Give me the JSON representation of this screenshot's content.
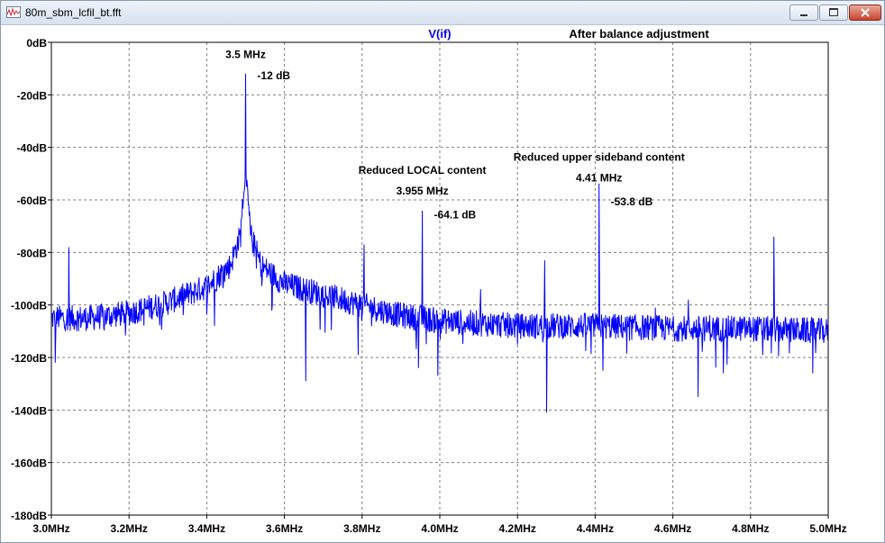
{
  "window": {
    "title": "80m_sbm_lcfil_bt.fft",
    "minimize_label": "minimize",
    "maximize_label": "maximize",
    "close_label": "close"
  },
  "colors": {
    "trace": "#0000ff",
    "axis": "#000000",
    "grid": "#808080",
    "text": "#000000"
  },
  "chart_data": {
    "type": "line",
    "title": "After balance adjustment",
    "trace_label": "V(if)",
    "xlabel": "",
    "ylabel": "",
    "xlim": [
      3.0,
      5.0
    ],
    "ylim": [
      -180,
      0
    ],
    "x_unit": "MHz",
    "y_unit": "dB",
    "grid": true,
    "x_ticks": [
      {
        "v": 3.0,
        "label": "3.0MHz"
      },
      {
        "v": 3.2,
        "label": "3.2MHz"
      },
      {
        "v": 3.4,
        "label": "3.4MHz"
      },
      {
        "v": 3.6,
        "label": "3.6MHz"
      },
      {
        "v": 3.8,
        "label": "3.8MHz"
      },
      {
        "v": 4.0,
        "label": "4.0MHz"
      },
      {
        "v": 4.2,
        "label": "4.2MHz"
      },
      {
        "v": 4.4,
        "label": "4.4MHz"
      },
      {
        "v": 4.6,
        "label": "4.6MHz"
      },
      {
        "v": 4.8,
        "label": "4.8MHz"
      },
      {
        "v": 5.0,
        "label": "5.0MHz"
      }
    ],
    "y_ticks": [
      {
        "v": 0,
        "label": "0dB"
      },
      {
        "v": -20,
        "label": "-20dB"
      },
      {
        "v": -40,
        "label": "-40dB"
      },
      {
        "v": -60,
        "label": "-60dB"
      },
      {
        "v": -80,
        "label": "-80dB"
      },
      {
        "v": -100,
        "label": "-100dB"
      },
      {
        "v": -120,
        "label": "-120dB"
      },
      {
        "v": -140,
        "label": "-140dB"
      },
      {
        "v": -160,
        "label": "-160dB"
      },
      {
        "v": -180,
        "label": "-180dB"
      }
    ],
    "peaks": [
      {
        "x": 3.5,
        "y": -12.0
      },
      {
        "x": 3.955,
        "y": -64.1
      },
      {
        "x": 4.41,
        "y": -53.8
      }
    ],
    "spurs": [
      {
        "x": 3.045,
        "y": -78
      },
      {
        "x": 3.185,
        "y": -104
      },
      {
        "x": 3.31,
        "y": -98
      },
      {
        "x": 3.42,
        "y": -108
      },
      {
        "x": 3.805,
        "y": -77
      },
      {
        "x": 3.98,
        "y": -110
      },
      {
        "x": 4.105,
        "y": -94
      },
      {
        "x": 4.27,
        "y": -83
      },
      {
        "x": 4.31,
        "y": -104
      },
      {
        "x": 4.435,
        "y": -108
      },
      {
        "x": 4.555,
        "y": -101
      },
      {
        "x": 4.64,
        "y": -98
      },
      {
        "x": 4.695,
        "y": -104
      },
      {
        "x": 4.86,
        "y": -74
      }
    ],
    "dips": [
      {
        "x": 3.01,
        "y": -122
      },
      {
        "x": 3.655,
        "y": -129
      },
      {
        "x": 3.79,
        "y": -119
      },
      {
        "x": 3.945,
        "y": -124
      },
      {
        "x": 3.995,
        "y": -127
      },
      {
        "x": 4.275,
        "y": -141
      },
      {
        "x": 4.42,
        "y": -125
      },
      {
        "x": 4.665,
        "y": -135
      },
      {
        "x": 4.73,
        "y": -126
      },
      {
        "x": 4.96,
        "y": -126
      }
    ],
    "noise_floor": [
      {
        "x": 3.0,
        "y": -105
      },
      {
        "x": 3.1,
        "y": -105
      },
      {
        "x": 3.2,
        "y": -103
      },
      {
        "x": 3.3,
        "y": -99
      },
      {
        "x": 3.4,
        "y": -93
      },
      {
        "x": 3.46,
        "y": -85
      },
      {
        "x": 3.49,
        "y": -72
      },
      {
        "x": 3.51,
        "y": -72
      },
      {
        "x": 3.54,
        "y": -85
      },
      {
        "x": 3.6,
        "y": -92
      },
      {
        "x": 3.7,
        "y": -96
      },
      {
        "x": 3.8,
        "y": -100
      },
      {
        "x": 3.9,
        "y": -104
      },
      {
        "x": 4.0,
        "y": -106
      },
      {
        "x": 4.2,
        "y": -108
      },
      {
        "x": 4.4,
        "y": -108
      },
      {
        "x": 4.6,
        "y": -109
      },
      {
        "x": 4.8,
        "y": -109
      },
      {
        "x": 5.0,
        "y": -110
      }
    ],
    "annotations": [
      {
        "text": "3.5 MHz",
        "x": 3.5,
        "y": -6
      },
      {
        "text": "-12 dB",
        "x": 3.53,
        "y": -14
      },
      {
        "text": "Reduced LOCAL content",
        "x": 3.955,
        "y": -50
      },
      {
        "text": "3.955 MHz",
        "x": 3.955,
        "y": -58
      },
      {
        "text": "-64.1 dB",
        "x": 3.985,
        "y": -67
      },
      {
        "text": "Reduced upper sideband content",
        "x": 4.41,
        "y": -45
      },
      {
        "text": "4.41 MHz",
        "x": 4.41,
        "y": -53
      },
      {
        "text": "-53.8 dB",
        "x": 4.44,
        "y": -62
      }
    ]
  }
}
